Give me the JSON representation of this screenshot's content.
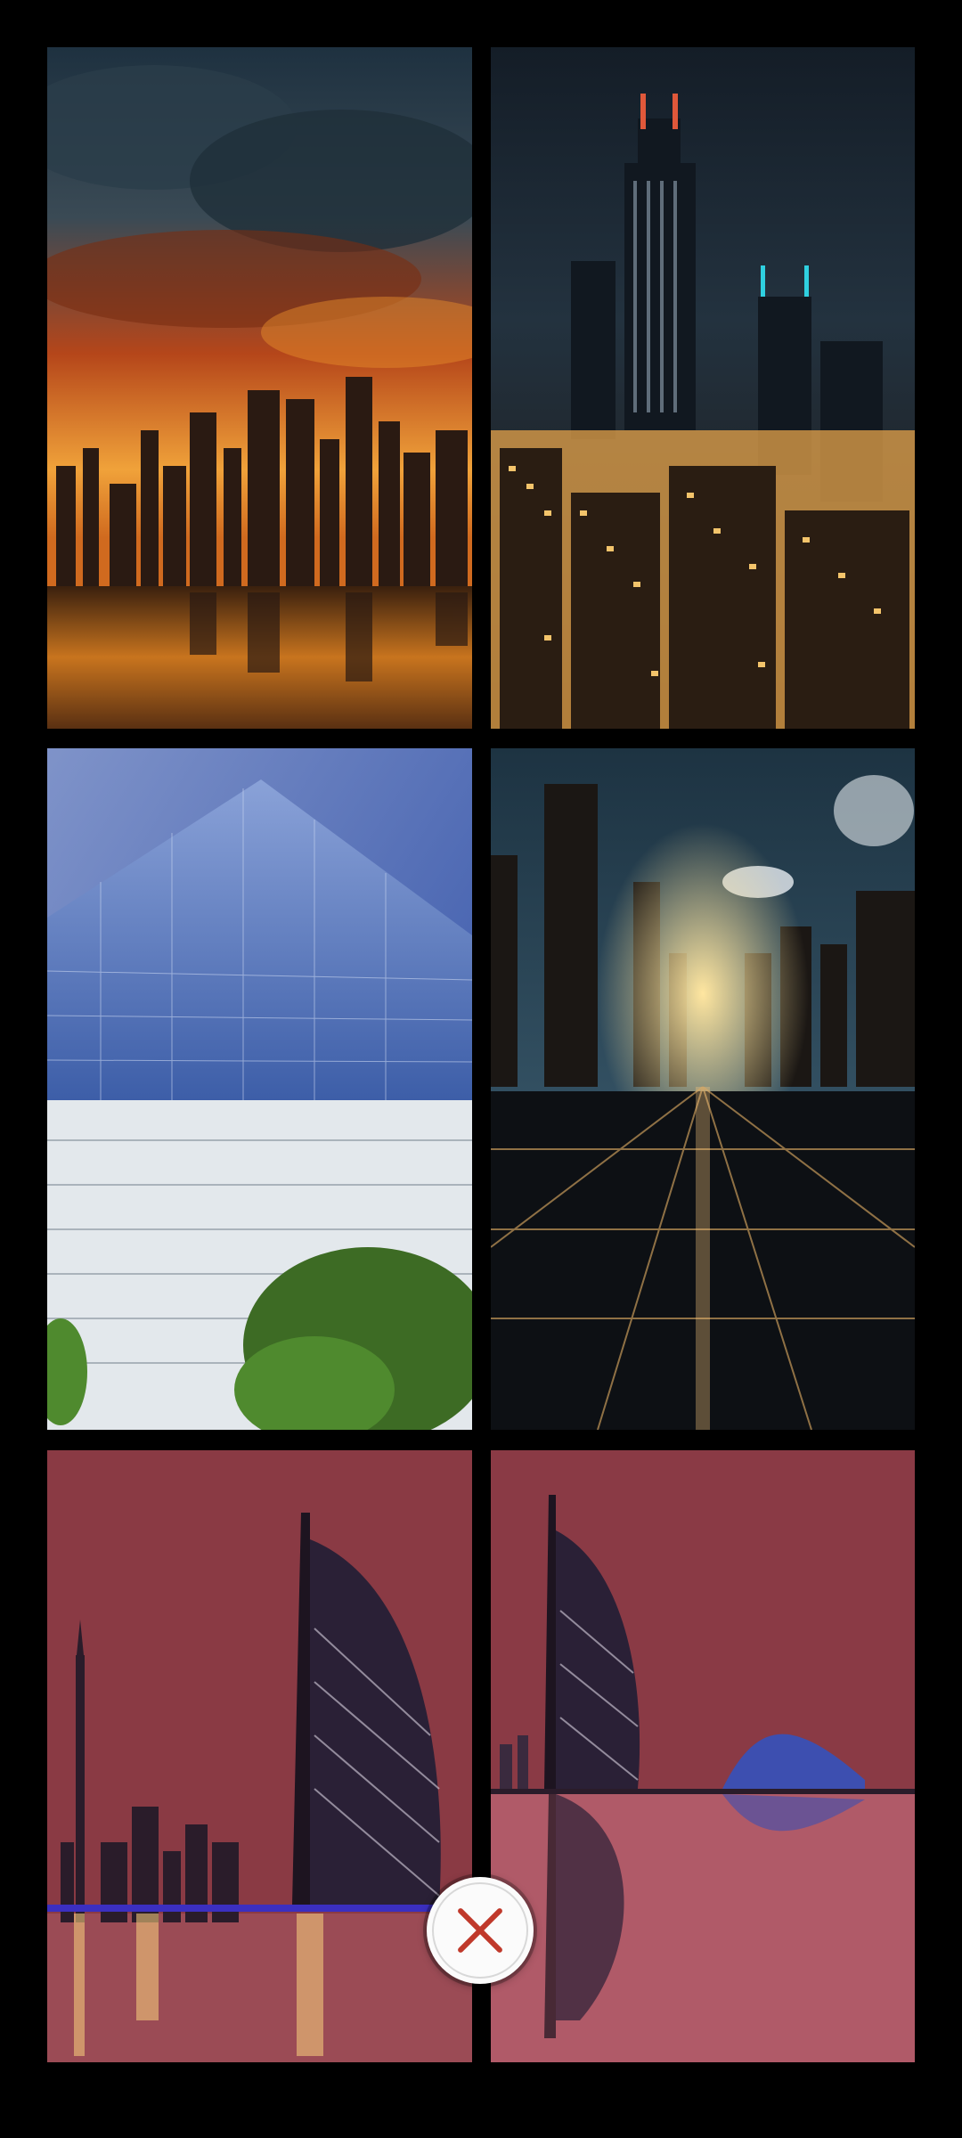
{
  "gallery": {
    "tiles": [
      {
        "subject": "stormy-city-skyline-reflection"
      },
      {
        "subject": "night-skyscrapers-city"
      },
      {
        "subject": "glass-pyramid-building"
      },
      {
        "subject": "futuristic-city-glass-floor-sunset"
      },
      {
        "subject": "dubai-skyline-burj-al-arab-night"
      },
      {
        "subject": "burj-al-arab-reflection-night"
      }
    ]
  },
  "close_button": {
    "icon": "close-icon",
    "color": "#c0392b"
  }
}
